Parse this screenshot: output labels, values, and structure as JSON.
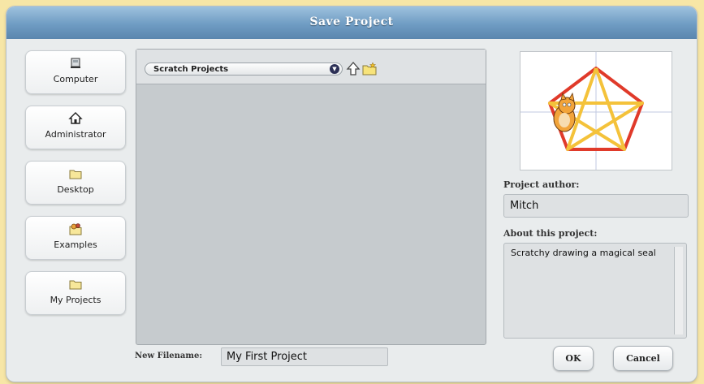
{
  "dialog": {
    "title": "Save Project"
  },
  "locations": [
    {
      "label": "Computer",
      "icon": "computer-icon"
    },
    {
      "label": "Administrator",
      "icon": "home-icon"
    },
    {
      "label": "Desktop",
      "icon": "folder-icon"
    },
    {
      "label": "Examples",
      "icon": "examples-icon"
    },
    {
      "label": "My Projects",
      "icon": "folder-icon"
    }
  ],
  "browser": {
    "path": "Scratch Projects",
    "up_icon": "up-arrow-icon",
    "new_folder_icon": "new-folder-icon"
  },
  "project": {
    "author_label": "Project author:",
    "author": "Mitch",
    "about_label": "About this project:",
    "about": "Scratchy drawing a magical seal"
  },
  "save": {
    "new_filename_label": "New Filename:",
    "filename": "My First Project",
    "ok_label": "OK",
    "cancel_label": "Cancel"
  },
  "colors": {
    "title_bar": "#7aa5cb",
    "pentagon_outer": "#e0362a",
    "pentagon_inner": "#f4c23a"
  }
}
